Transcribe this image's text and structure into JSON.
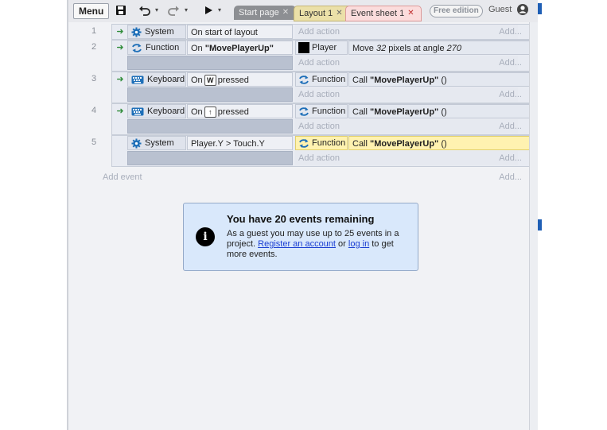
{
  "toolbar": {
    "menu_label": "Menu",
    "tabs": [
      {
        "label": "Start page"
      },
      {
        "label": "Layout 1"
      },
      {
        "label": "Event sheet 1"
      }
    ],
    "edition_badge": "Free edition",
    "user_label": "Guest"
  },
  "events": [
    {
      "number": "1",
      "object": "System",
      "condition": "On start of layout",
      "add_action": "Add action",
      "add_right": "Add..."
    },
    {
      "number": "2",
      "object": "Function",
      "condition_prefix": "On ",
      "condition_bold": "\"MovePlayerUp\"",
      "action_object": "Player",
      "action_prefix": "Move ",
      "action_num1": "32",
      "action_mid": " pixels at angle ",
      "action_num2": "270",
      "add_right_1": "Add...",
      "add_action": "Add action",
      "add_right_2": "Add..."
    },
    {
      "number": "3",
      "object": "Keyboard",
      "condition_prefix": "On",
      "key": "W",
      "condition_suffix": "pressed",
      "action_object": "Function",
      "action_prefix": "Call ",
      "action_bold": "\"MovePlayerUp\"",
      "action_suffix": " ()",
      "add_action": "Add action",
      "add_right": "Add..."
    },
    {
      "number": "4",
      "object": "Keyboard",
      "condition_prefix": "On",
      "key": "↑",
      "condition_suffix": "pressed",
      "action_object": "Function",
      "action_prefix": "Call ",
      "action_bold": "\"MovePlayerUp\"",
      "action_suffix": " ()",
      "add_action": "Add action",
      "add_right": "Add..."
    },
    {
      "number": "5",
      "object": "System",
      "condition": "Player.Y > Touch.Y",
      "action_object": "Function",
      "action_prefix": "Call ",
      "action_bold": "\"MovePlayerUp\"",
      "action_suffix": " ()",
      "add_action": "Add action",
      "add_right": "Add..."
    }
  ],
  "add_event": "Add event",
  "add_event_right": "Add...",
  "notice": {
    "icon": "i",
    "title": "You have 20 events remaining",
    "body_1": "As a guest you may use up to 25 events in a project. ",
    "link_register": "Register an account",
    "body_2": " or ",
    "link_login": "log in",
    "body_3": " to get more events."
  },
  "colors": {
    "accent_link": "#1a3ed2",
    "selected_action": "#fff2b0",
    "condition_arrow": "#2f8c3a",
    "function_icon": "#1e6fb8"
  },
  "icons": {
    "system": "gear-icon",
    "function": "function-arrows-icon",
    "keyboard": "keyboard-icon",
    "player": "player-square-icon",
    "save": "save-icon",
    "undo": "undo-icon",
    "redo": "redo-icon",
    "play": "play-icon",
    "user": "user-avatar-icon",
    "info": "info-icon"
  }
}
